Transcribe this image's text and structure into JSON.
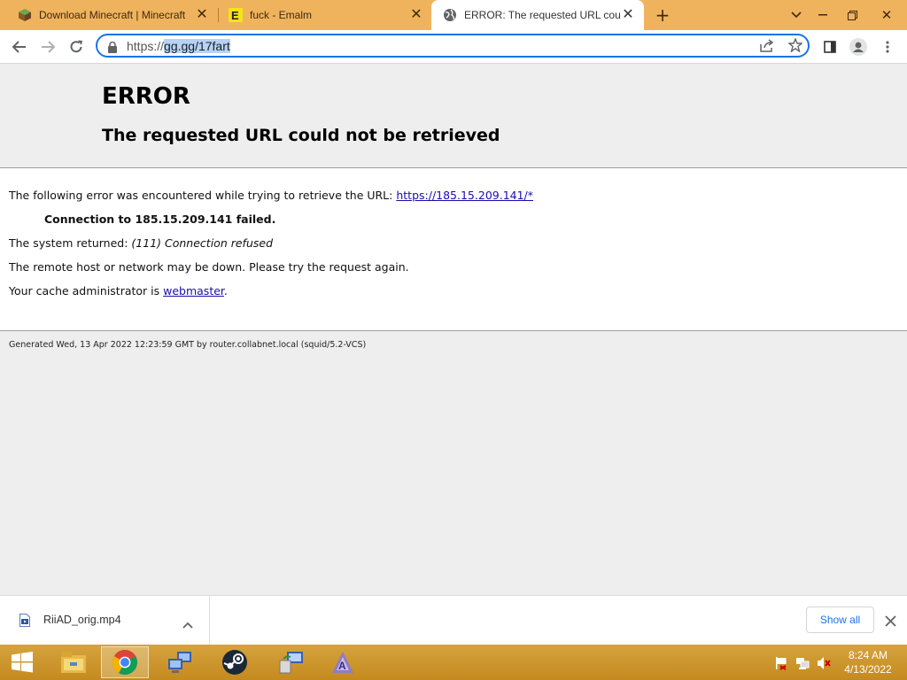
{
  "tabs": [
    {
      "title": "Download Minecraft | Minecraft",
      "icon": "minecraft-grass-icon",
      "active": false
    },
    {
      "title": "fuck - Emalm",
      "icon": "emalm-e-icon",
      "active": false
    },
    {
      "title": "ERROR: The requested URL could",
      "icon": "globe-icon",
      "active": true
    }
  ],
  "address_bar": {
    "scheme": "https://",
    "host_path": "gg.gg/17fart"
  },
  "page": {
    "heading": "ERROR",
    "subheading": "The requested URL could not be retrieved",
    "line1_text": "The following error was encountered while trying to retrieve the URL: ",
    "line1_link": "https://185.15.209.141/*",
    "line2": "Connection to 185.15.209.141 failed.",
    "line3_text": "The system returned: ",
    "line3_em": "(111) Connection refused",
    "line4": "The remote host or network may be down. Please try the request again.",
    "line5_text": "Your cache administrator is ",
    "line5_link": "webmaster",
    "line5_end": ".",
    "footer": "Generated Wed, 13 Apr 2022 12:23:59 GMT by router.collabnet.local (squid/5.2-VCS)"
  },
  "download_bar": {
    "filename": "RiiAD_orig.mp4",
    "show_all_label": "Show all"
  },
  "taskbar": {
    "time": "8:24 AM",
    "date": "4/13/2022"
  },
  "colors": {
    "tabstrip": "#f0b35d",
    "taskbar": "#c48a1f",
    "accent": "#1a73e8"
  }
}
